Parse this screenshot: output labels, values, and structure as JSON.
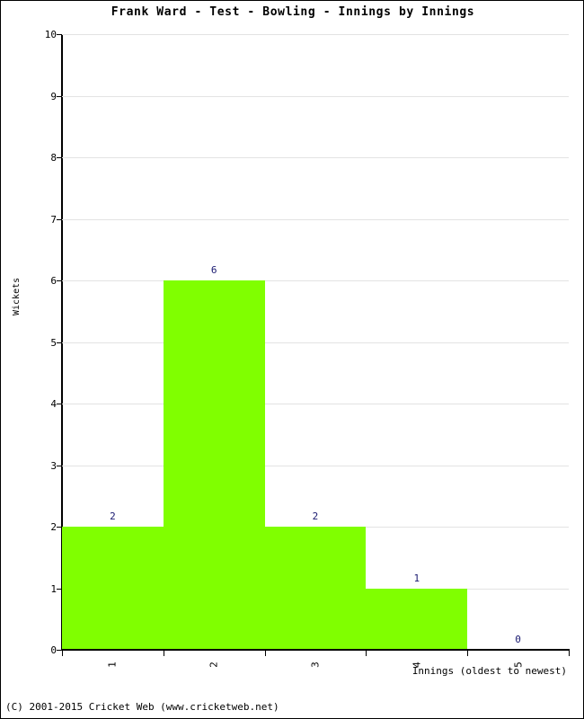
{
  "chart_data": {
    "type": "bar",
    "title": "Frank Ward - Test - Bowling - Innings by Innings",
    "xlabel": "Innings (oldest to newest)",
    "ylabel": "Wickets",
    "categories": [
      "1",
      "2",
      "3",
      "4",
      "5"
    ],
    "values": [
      2,
      6,
      2,
      1,
      0
    ],
    "ylim": [
      0,
      10
    ],
    "ytick_labels": [
      "0",
      "1",
      "2",
      "3",
      "4",
      "5",
      "6",
      "7",
      "8",
      "9",
      "10"
    ],
    "ytick_values": [
      0,
      1,
      2,
      3,
      4,
      5,
      6,
      7,
      8,
      9,
      10
    ],
    "grid": true,
    "legend": false,
    "bar_color": "#80ff00",
    "value_label_color": "#191970",
    "gridline_color": "#e3e3e3",
    "axis_color": "#000000",
    "value_labels": [
      "2",
      "6",
      "2",
      "1",
      "0"
    ]
  },
  "footer": {
    "copyright": "(C) 2001-2015 Cricket Web (www.cricketweb.net)"
  }
}
